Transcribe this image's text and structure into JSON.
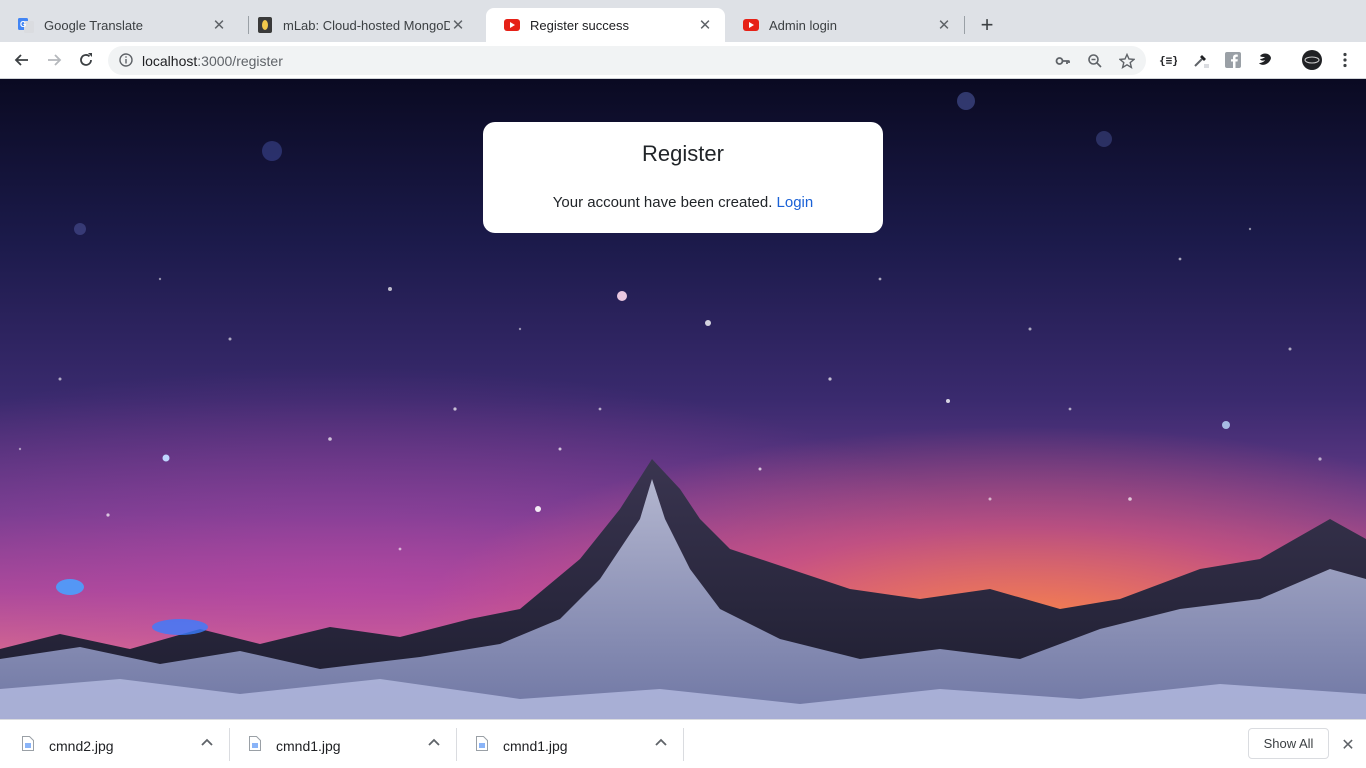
{
  "tabs": [
    {
      "title": "Google Translate",
      "favicon": "google-translate-icon",
      "active": false
    },
    {
      "title": "mLab: Cloud-hosted MongoDB",
      "favicon": "mlab-icon",
      "active": false
    },
    {
      "title": "Register success",
      "favicon": "youtube-play-icon",
      "active": true
    },
    {
      "title": "Admin login",
      "favicon": "youtube-play-icon",
      "active": false
    }
  ],
  "toolbar": {
    "url_host": "localhost",
    "url_path": ":3000/register"
  },
  "card": {
    "title": "Register",
    "message": "Your account have been created.",
    "link_label": "Login"
  },
  "downloads": {
    "items": [
      {
        "name": "cmnd2.jpg"
      },
      {
        "name": "cmnd1.jpg"
      },
      {
        "name": "cmnd1.jpg"
      }
    ],
    "show_all_label": "Show All"
  },
  "colors": {
    "link": "#1a61d6",
    "youtube_red": "#e62117",
    "translate_blue": "#4285f4"
  }
}
